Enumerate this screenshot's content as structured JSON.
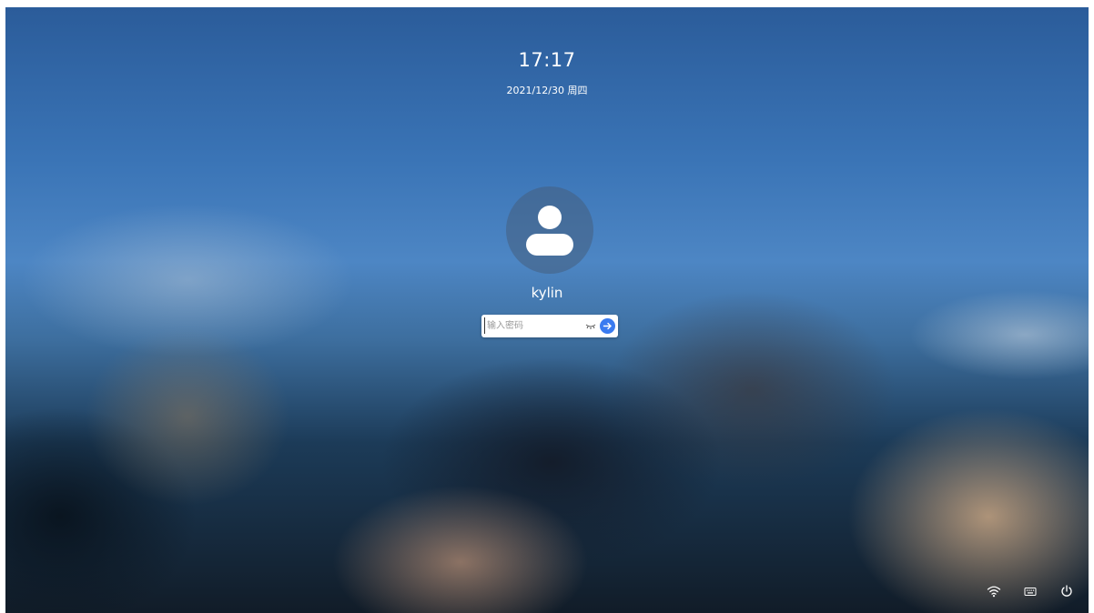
{
  "lockscreen": {
    "time": "17:17",
    "date": "2021/12/30 周四",
    "username": "kylin"
  },
  "password": {
    "value": "",
    "placeholder": "输入密码"
  },
  "icons": {
    "avatar": "user-avatar-icon",
    "show_password": "eye-closed-icon",
    "submit": "arrow-right-icon",
    "wifi": "wifi-icon",
    "keyboard": "keyboard-icon",
    "power": "power-icon"
  },
  "colors": {
    "accent": "#3a7bf0",
    "text": "#ffffff"
  }
}
